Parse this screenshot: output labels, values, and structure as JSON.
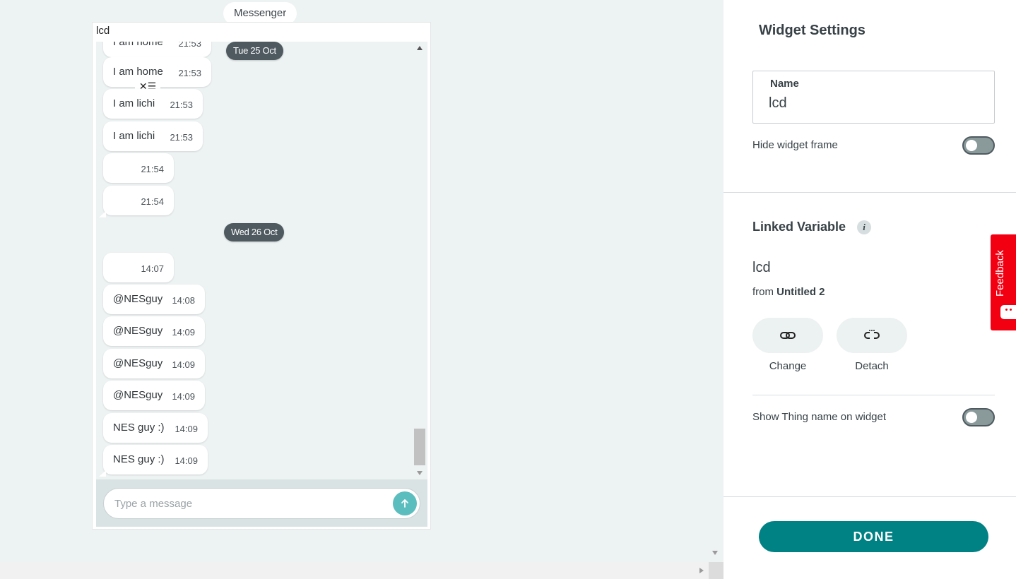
{
  "widget": {
    "tab_label": "Messenger",
    "title": "lcd"
  },
  "messages": [
    {
      "text": "I am home",
      "time": "21:53"
    },
    {
      "text": "I am home",
      "time": "21:53"
    },
    {
      "text": "I am lichi",
      "time": "21:53"
    },
    {
      "text": "I am lichi",
      "time": "21:53"
    },
    {
      "text": "",
      "time": "21:54"
    },
    {
      "text": "",
      "time": "21:54"
    },
    {
      "text": "",
      "time": "14:07"
    },
    {
      "text": "@NESguy",
      "time": "14:08"
    },
    {
      "text": "@NESguy",
      "time": "14:09"
    },
    {
      "text": "@NESguy",
      "time": "14:09"
    },
    {
      "text": "@NESguy",
      "time": "14:09"
    },
    {
      "text": "NES guy :)",
      "time": "14:09"
    },
    {
      "text": "NES guy :)",
      "time": "14:09"
    }
  ],
  "dates": [
    "Tue 25 Oct",
    "Wed 26 Oct"
  ],
  "composer": {
    "placeholder": "Type a message"
  },
  "settings": {
    "title": "Widget Settings",
    "name_label": "Name",
    "name_value": "lcd",
    "hide_frame_label": "Hide widget frame",
    "hide_frame_on": false,
    "linked_variable_title": "Linked Variable",
    "variable_name": "lcd",
    "from_prefix": "from",
    "thing_name": "Untitled 2",
    "change_label": "Change",
    "detach_label": "Detach",
    "show_thing_label": "Show Thing name on widget",
    "show_thing_on": false,
    "done_label": "DONE"
  },
  "feedback": {
    "label": "Feedback"
  },
  "colors": {
    "accent": "#008184",
    "send": "#5bbdbd",
    "feedback": "#f20012",
    "date_pill": "#4e5a60"
  }
}
